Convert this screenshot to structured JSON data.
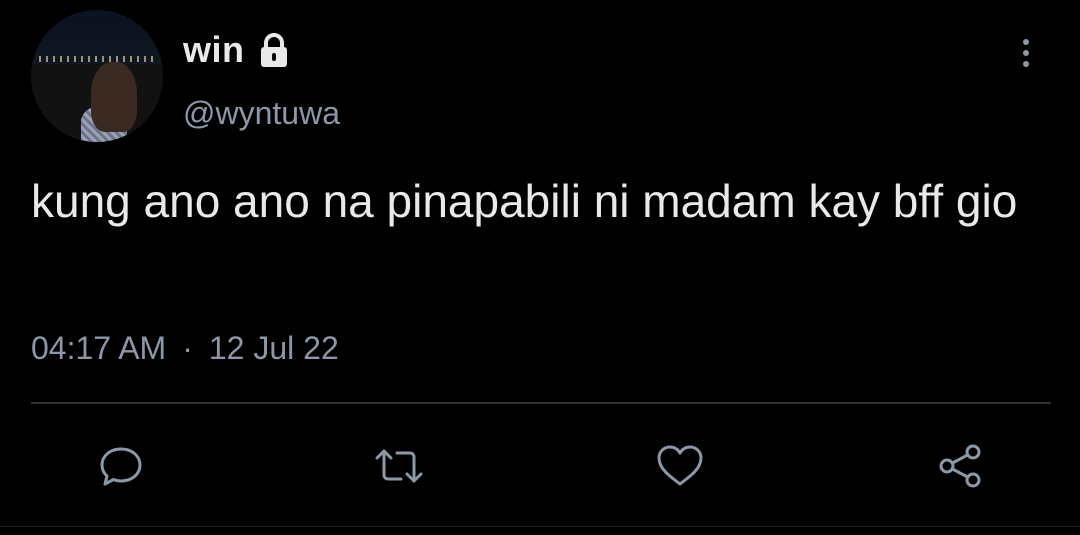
{
  "tweet": {
    "display_name": "win",
    "handle": "@wyntuwa",
    "text": "kung ano ano na pinapabili ni madam kay bff gio",
    "time": "04:17 AM",
    "separator": "·",
    "date": "12 Jul 22"
  },
  "icons": {
    "lock": "lock-icon",
    "more": "more-vertical-icon",
    "reply": "reply-icon",
    "retweet": "retweet-icon",
    "like": "heart-icon",
    "share": "share-icon"
  },
  "colors": {
    "background": "#000000",
    "primary_text": "#e7e9ea",
    "secondary_text": "#8b98a5",
    "divider": "#2f3336"
  }
}
